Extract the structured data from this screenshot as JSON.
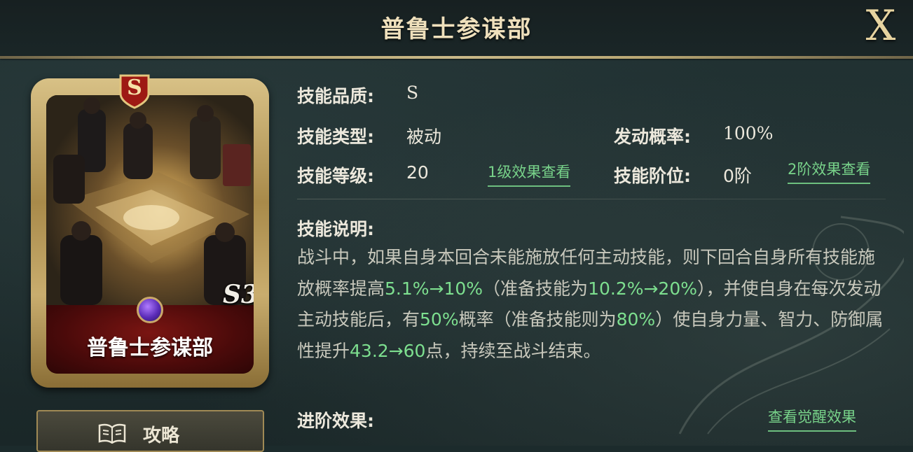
{
  "window": {
    "title": "普鲁士参谋部",
    "close_label": "X"
  },
  "card": {
    "name": "普鲁士参谋部",
    "quality_badge": "S",
    "grade_mark": "S3",
    "gem_icon": "purple-gem-icon"
  },
  "guide_button": {
    "label": "攻略",
    "icon": "book-icon"
  },
  "info": {
    "quality_label": "技能品质:",
    "quality_value": "S",
    "type_label": "技能类型:",
    "type_value": "被动",
    "trigger_label": "发动概率:",
    "trigger_value": "100%",
    "level_label": "技能等级:",
    "level_value": "20",
    "level_link": "1级效果查看",
    "tier_label": "技能阶位:",
    "tier_value": "0阶",
    "tier_link": "2阶效果查看"
  },
  "description": {
    "label": "技能说明:",
    "segments": [
      {
        "t": "战斗中，如果自身本回合未能施放任何主动技能，则下回合自身所有技能施放概率提高",
        "hl": false
      },
      {
        "t": "5.1%→10%",
        "hl": true
      },
      {
        "t": "（准备技能为",
        "hl": false
      },
      {
        "t": "10.2%→20%",
        "hl": true
      },
      {
        "t": "），并使自身在每次发动主动技能后，有",
        "hl": false
      },
      {
        "t": "50%",
        "hl": true
      },
      {
        "t": "概率（准备技能则为",
        "hl": false
      },
      {
        "t": "80%",
        "hl": true
      },
      {
        "t": "）使自身力量、智力、防御属性提升",
        "hl": false
      },
      {
        "t": "43.2→60",
        "hl": true
      },
      {
        "t": "点，持续至战斗结束。",
        "hl": false
      }
    ]
  },
  "advance": {
    "label": "进阶效果:",
    "link": "查看觉醒效果"
  },
  "colors": {
    "highlight": "#7ddf8f",
    "gold": "#c9b988",
    "background": "#1e2d2e"
  }
}
